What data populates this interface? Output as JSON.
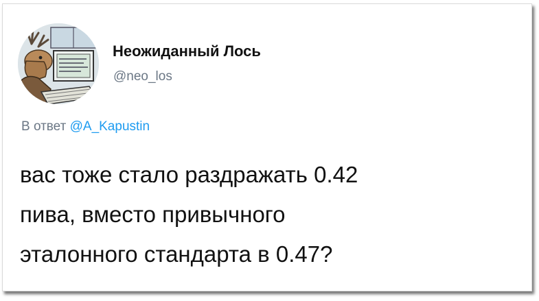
{
  "author": {
    "display_name": "Неожиданный Лось",
    "handle": "@neo_los"
  },
  "reply": {
    "prefix": "В ответ",
    "mention": "@A_Kapustin"
  },
  "tweet": {
    "lines": [
      "вас тоже стало раздражать 0.42",
      "пива, вместо привычного",
      "эталонного стандарта в 0.47?"
    ]
  },
  "colors": {
    "link": "#1d9bf0",
    "secondary_text": "#6b7785",
    "primary_text": "#111111"
  },
  "icons": {
    "avatar": "moose-at-computer-avatar"
  }
}
